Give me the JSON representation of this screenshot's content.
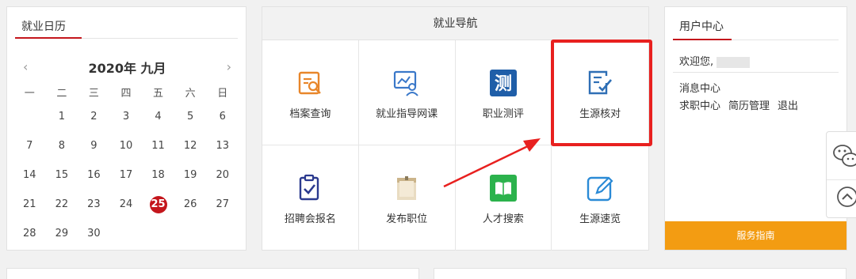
{
  "calendar": {
    "title": "就业日历",
    "month_label": "2020年 九月",
    "prev": "‹",
    "next": "›",
    "weekdays": [
      "一",
      "二",
      "三",
      "四",
      "五",
      "六",
      "日"
    ],
    "days": [
      "",
      "1",
      "2",
      "3",
      "4",
      "5",
      "6",
      "7",
      "8",
      "9",
      "10",
      "11",
      "12",
      "13",
      "14",
      "15",
      "16",
      "17",
      "18",
      "19",
      "20",
      "21",
      "22",
      "23",
      "24",
      "25",
      "26",
      "27",
      "28",
      "29",
      "30",
      "",
      "",
      "",
      ""
    ],
    "today": "25",
    "accent": "#c4161c"
  },
  "nav": {
    "title": "就业导航",
    "items": [
      {
        "label": "档案查询",
        "icon": "archive-search-icon"
      },
      {
        "label": "就业指导网课",
        "icon": "online-course-icon"
      },
      {
        "label": "职业测评",
        "icon": "assessment-icon",
        "glyph": "测"
      },
      {
        "label": "生源核对",
        "icon": "verify-checklist-icon"
      },
      {
        "label": "招聘会报名",
        "icon": "job-fair-register-icon"
      },
      {
        "label": "发布职位",
        "icon": "post-job-icon"
      },
      {
        "label": "人才搜索",
        "icon": "talent-search-icon"
      },
      {
        "label": "生源速览",
        "icon": "quick-view-edit-icon"
      }
    ]
  },
  "user": {
    "title": "用户中心",
    "welcome": "欢迎您,",
    "message_center": "消息中心",
    "job_center": "求职中心",
    "resume": "简历管理",
    "logout": "退出",
    "service_guide": "服务指南",
    "button_color": "#f39c12"
  },
  "side": {
    "wechat_icon": "wechat-icon",
    "top_icon": "back-to-top-icon"
  }
}
